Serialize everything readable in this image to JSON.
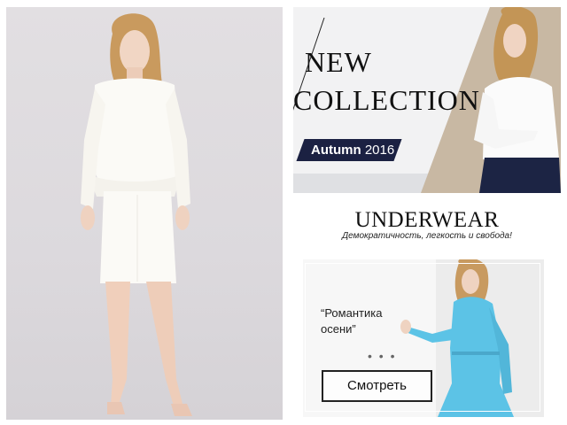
{
  "collection_banner": {
    "title_line1": "NEW",
    "title_line2": "COLLECTION",
    "season_name": "Autumn",
    "season_year": "2016"
  },
  "underwear": {
    "title": "UNDERWEAR",
    "tagline": "Демократичность, легкость и свобода!"
  },
  "promo": {
    "heading": "“Романтика осени”",
    "dots": "• • •",
    "button_label": "Смотреть"
  },
  "colors": {
    "badge_bg": "#1b2142",
    "dress": "#fbfaf6",
    "blue_dress": "#5cc3e6",
    "navy_pants": "#1c2444",
    "hair": "#c99a5e"
  }
}
